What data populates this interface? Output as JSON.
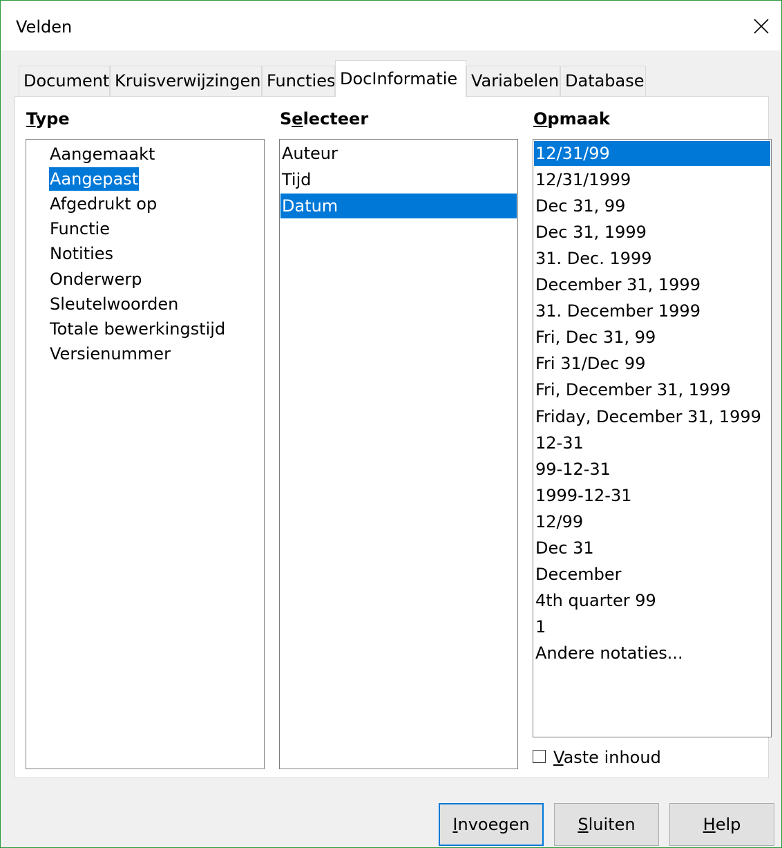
{
  "window": {
    "title": "Velden",
    "close_icon": "close-icon"
  },
  "tabs": [
    {
      "label": "Document",
      "active": false
    },
    {
      "label": "Kruisverwijzingen",
      "active": false
    },
    {
      "label": "Functies",
      "active": false
    },
    {
      "label": "DocInformatie",
      "active": true
    },
    {
      "label": "Variabelen",
      "active": false
    },
    {
      "label": "Database",
      "active": false
    }
  ],
  "type": {
    "header_mnemonic": "T",
    "header_rest": "ype",
    "items": [
      "Aangemaakt",
      "Aangepast",
      "Afgedrukt op",
      "Functie",
      "Notities",
      "Onderwerp",
      "Sleutelwoorden",
      "Totale bewerkingstijd",
      "Versienummer"
    ],
    "selected_index": 1
  },
  "select": {
    "header_pre": "S",
    "header_mnemonic": "e",
    "header_rest": "lecteer",
    "items": [
      "Auteur",
      "Tijd",
      "Datum"
    ],
    "selected_index": 2
  },
  "format": {
    "header_mnemonic": "O",
    "header_rest": "pmaak",
    "items": [
      "12/31/99",
      "12/31/1999",
      "Dec 31, 99",
      "Dec 31, 1999",
      "31. Dec. 1999",
      "December 31, 1999",
      "31. December 1999",
      "Fri, Dec 31, 99",
      "Fri 31/Dec 99",
      "Fri, December 31, 1999",
      "Friday, December 31, 1999",
      "12-31",
      "99-12-31",
      "1999-12-31",
      "12/99",
      "Dec 31",
      "December",
      "4th quarter 99",
      "1",
      "Andere notaties..."
    ],
    "selected_index": 0
  },
  "fixed_content": {
    "mnemonic": "V",
    "rest": "aste inhoud",
    "checked": false
  },
  "buttons": {
    "insert": {
      "mnemonic": "I",
      "rest": "nvoegen"
    },
    "close": {
      "mnemonic": "S",
      "rest": "luiten"
    },
    "help": {
      "mnemonic": "H",
      "rest": "elp"
    }
  },
  "colors": {
    "selection": "#0078d7",
    "window_border": "#2a9a3a"
  }
}
